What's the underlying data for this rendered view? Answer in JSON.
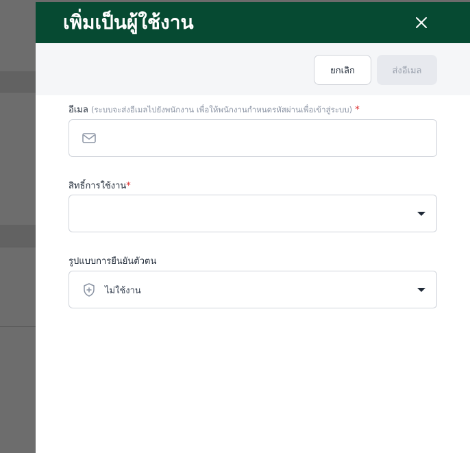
{
  "drawer": {
    "title": "เพิ่มเป็นผู้ใช้งาน",
    "close_icon": "close-icon"
  },
  "actions": {
    "cancel_label": "ยกเลิก",
    "send_label": "ส่งอีเมล"
  },
  "form": {
    "email": {
      "label": "อีเมล",
      "hint": "(ระบบจะส่งอีเมลไปยังพนักงาน เพื่อให้พนักงานกำหนดรหัสผ่านเพื่อเข้าสู่ระบบ)",
      "required_mark": "*",
      "value": "",
      "icon": "envelope-icon"
    },
    "permission": {
      "label": "สิทธิ์การใช้งาน",
      "required_mark": "*",
      "value": ""
    },
    "auth": {
      "label": "รูปแบบการยืนยันตัวตน",
      "value": "ไม่ใช้งาน",
      "icon": "shield-plus-icon"
    }
  },
  "colors": {
    "header_bg": "#064a32",
    "required": "#dc2626",
    "disabled_button_bg": "#e7e9ee"
  }
}
